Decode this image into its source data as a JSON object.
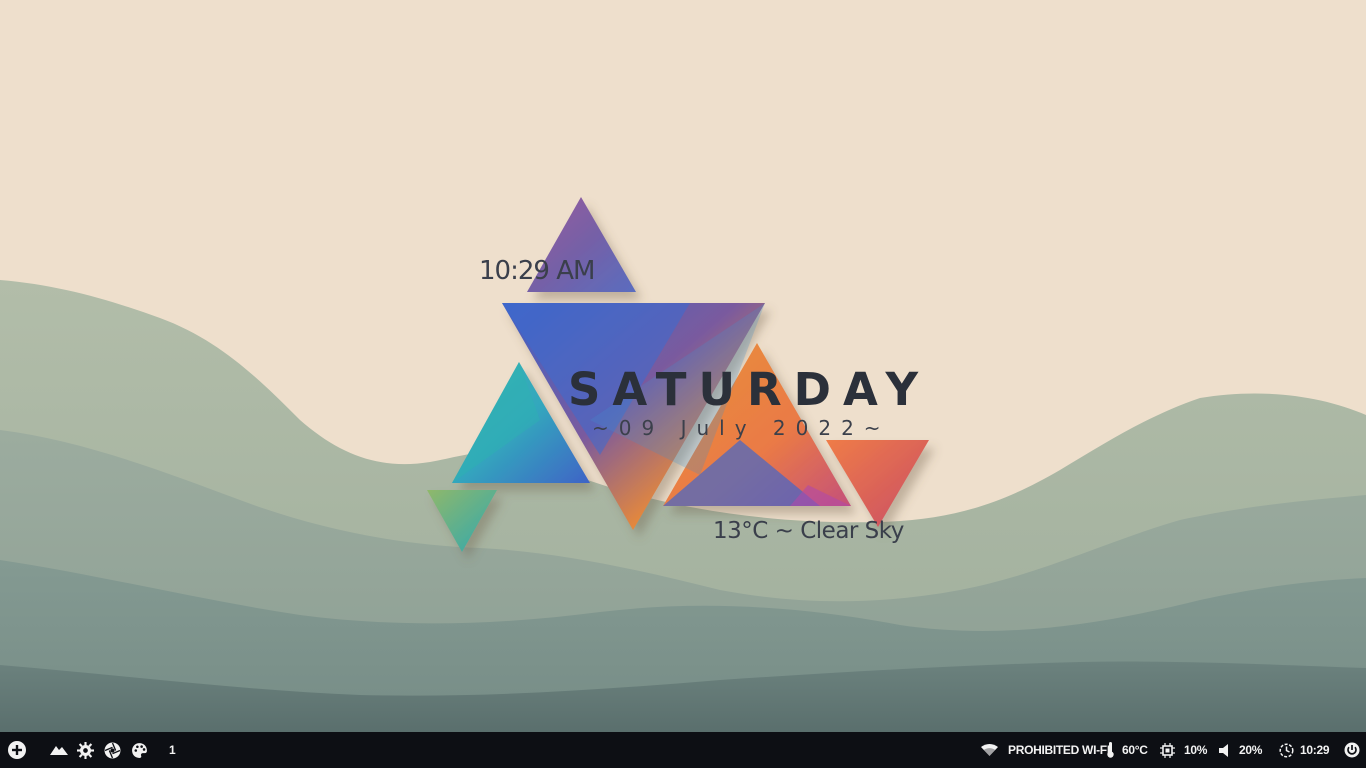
{
  "widget": {
    "time": "10:29 AM",
    "day": "SATURDAY",
    "date": "~09 July 2022~",
    "weather": "13°C ~ Clear Sky"
  },
  "panel": {
    "workspace": "1",
    "wifi_label": "PROHIBITED WI-FI",
    "temperature": "60°C",
    "cpu": "10%",
    "volume": "20%",
    "clock": "10:29"
  },
  "colors": {
    "panel_bg": "#0d0f14",
    "sand": "#efe2cf",
    "hills": "#6f857e",
    "accent_blue": "#3e6cc9",
    "accent_orange": "#ef9a2d",
    "accent_purple": "#7a5aa0"
  },
  "icons": [
    "plus-circle-icon",
    "mountain-icon",
    "gear-icon",
    "aperture-icon",
    "palette-icon",
    "wifi-icon",
    "thermometer-icon",
    "cpu-icon",
    "volume-icon",
    "clock-icon",
    "power-icon"
  ]
}
